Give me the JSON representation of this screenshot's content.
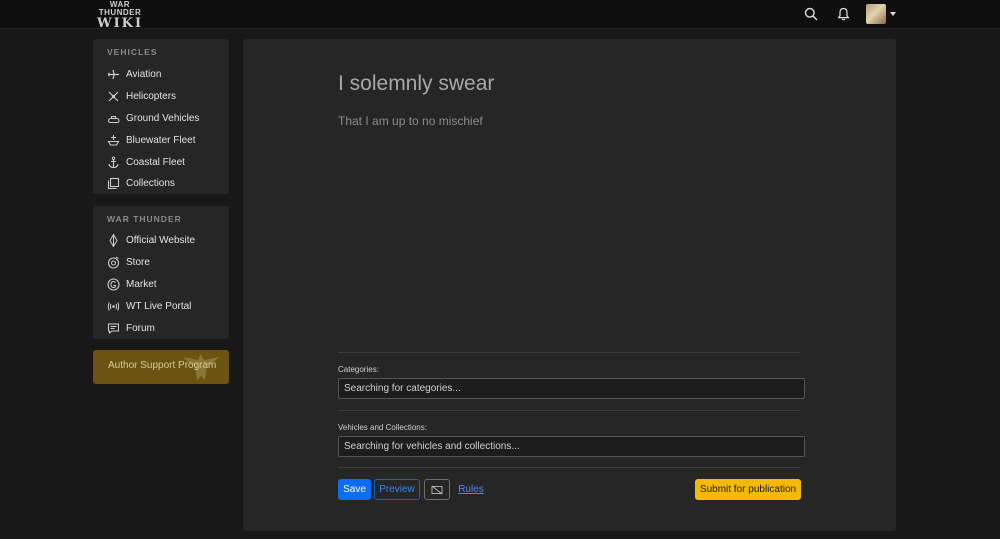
{
  "header": {
    "logo_line1": "WAR THUNDER",
    "logo_line2": "WIKI",
    "icons": [
      "search-icon",
      "bell-icon",
      "avatar"
    ]
  },
  "sidebar": {
    "vehicles": {
      "title": "VEHICLES",
      "items": [
        {
          "label": "Aviation",
          "icon": "plane-icon"
        },
        {
          "label": "Helicopters",
          "icon": "helicopter-icon"
        },
        {
          "label": "Ground Vehicles",
          "icon": "tank-icon"
        },
        {
          "label": "Bluewater Fleet",
          "icon": "ship-icon"
        },
        {
          "label": "Coastal Fleet",
          "icon": "anchor-icon"
        },
        {
          "label": "Collections",
          "icon": "collections-icon"
        }
      ]
    },
    "war_thunder": {
      "title": "WAR THUNDER",
      "items": [
        {
          "label": "Official Website",
          "icon": "website-icon"
        },
        {
          "label": "Store",
          "icon": "store-icon"
        },
        {
          "label": "Market",
          "icon": "market-icon"
        },
        {
          "label": "WT Live Portal",
          "icon": "broadcast-icon"
        },
        {
          "label": "Forum",
          "icon": "forum-icon"
        }
      ]
    },
    "author_support": "Author Support Program"
  },
  "editor": {
    "title_placeholder": "I solemnly swear",
    "subtitle": "That I am up to no mischief",
    "categories_label": "Categories:",
    "categories_placeholder": "Searching for categories...",
    "vehicles_label": "Vehicles and Collections:",
    "vehicles_placeholder": "Searching for vehicles and collections..."
  },
  "actions": {
    "save": "Save",
    "preview": "Preview",
    "rules": "Rules",
    "publish": "Submit for publication"
  },
  "colors": {
    "primary": "#0b6cf6",
    "publish": "#f5b908",
    "author_support_bg": "#6b5413"
  }
}
